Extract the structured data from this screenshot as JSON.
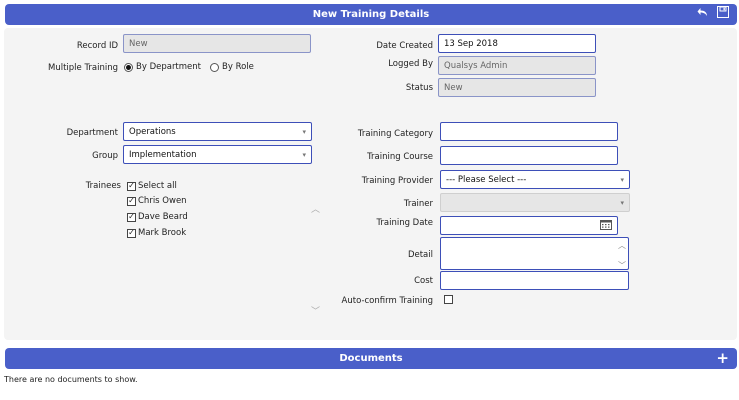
{
  "header": {
    "title": "New Training Details",
    "icons": [
      "undo-icon",
      "save-icon"
    ]
  },
  "form": {
    "record_id": {
      "label": "Record ID",
      "value": "New"
    },
    "multiple_training": {
      "label": "Multiple Training",
      "options": [
        "By Department",
        "By Role"
      ],
      "selected": "By Department"
    },
    "date_created": {
      "label": "Date Created",
      "value": "13 Sep 2018"
    },
    "logged_by": {
      "label": "Logged By",
      "value": "Qualsys Admin"
    },
    "status": {
      "label": "Status",
      "value": "New"
    },
    "department": {
      "label": "Department",
      "value": "Operations"
    },
    "group": {
      "label": "Group",
      "value": "Implementation"
    },
    "trainees": {
      "label": "Trainees",
      "select_all": "Select all",
      "items": [
        {
          "name": "Chris Owen",
          "checked": true
        },
        {
          "name": "Dave Beard",
          "checked": true
        },
        {
          "name": "Mark Brook",
          "checked": true
        }
      ]
    },
    "training_category": {
      "label": "Training Category",
      "value": ""
    },
    "training_course": {
      "label": "Training Course",
      "value": ""
    },
    "training_provider": {
      "label": "Training Provider",
      "value": "--- Please Select ---"
    },
    "trainer": {
      "label": "Trainer",
      "value": ""
    },
    "training_date": {
      "label": "Training Date",
      "value": ""
    },
    "detail": {
      "label": "Detail",
      "value": ""
    },
    "cost": {
      "label": "Cost",
      "value": ""
    },
    "auto_confirm": {
      "label": "Auto-confirm Training",
      "checked": false
    }
  },
  "documents": {
    "title": "Documents",
    "empty_message": "There are no documents to show."
  },
  "colors": {
    "header_bg": "#4a5fc9",
    "field_border": "#3d4fb8",
    "panel_bg": "#f4f4f4"
  }
}
